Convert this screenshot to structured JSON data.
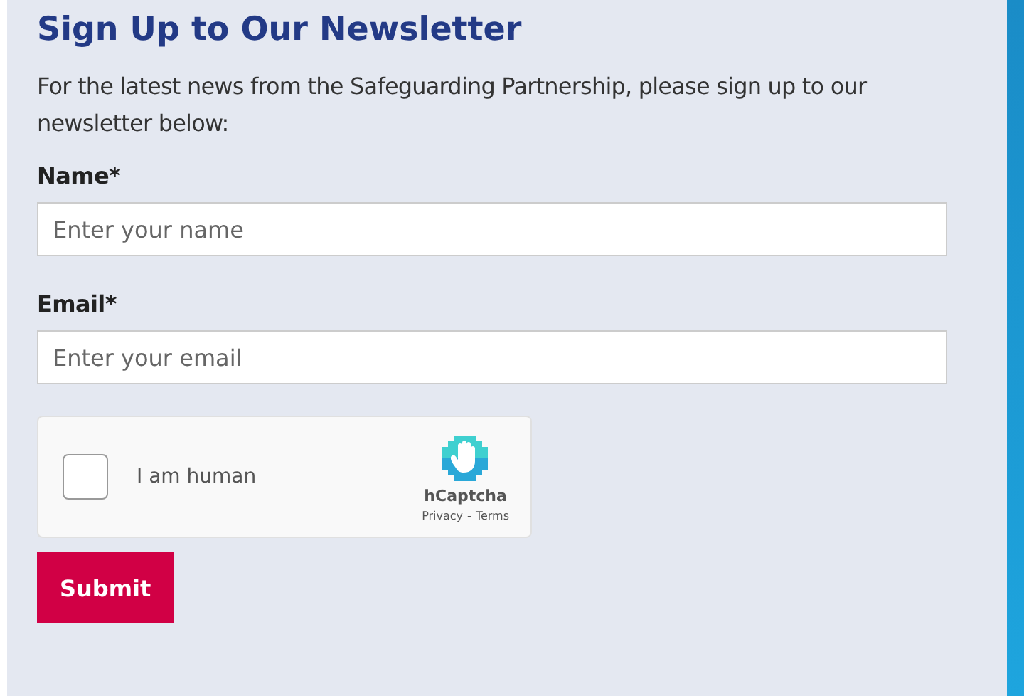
{
  "title": "Sign Up to Our Newsletter",
  "intro": "For the latest news from the Safeguarding Partnership, please sign up to our newsletter below:",
  "fields": [
    {
      "label": "Name*",
      "placeholder": "Enter your name"
    },
    {
      "label": "Email*",
      "placeholder": "Enter your email"
    }
  ],
  "captcha": {
    "label": "I am human",
    "checked": false,
    "brand": "hCaptcha",
    "links": [
      "Privacy",
      "Terms"
    ],
    "separator": "-"
  },
  "submit": "Submit"
}
